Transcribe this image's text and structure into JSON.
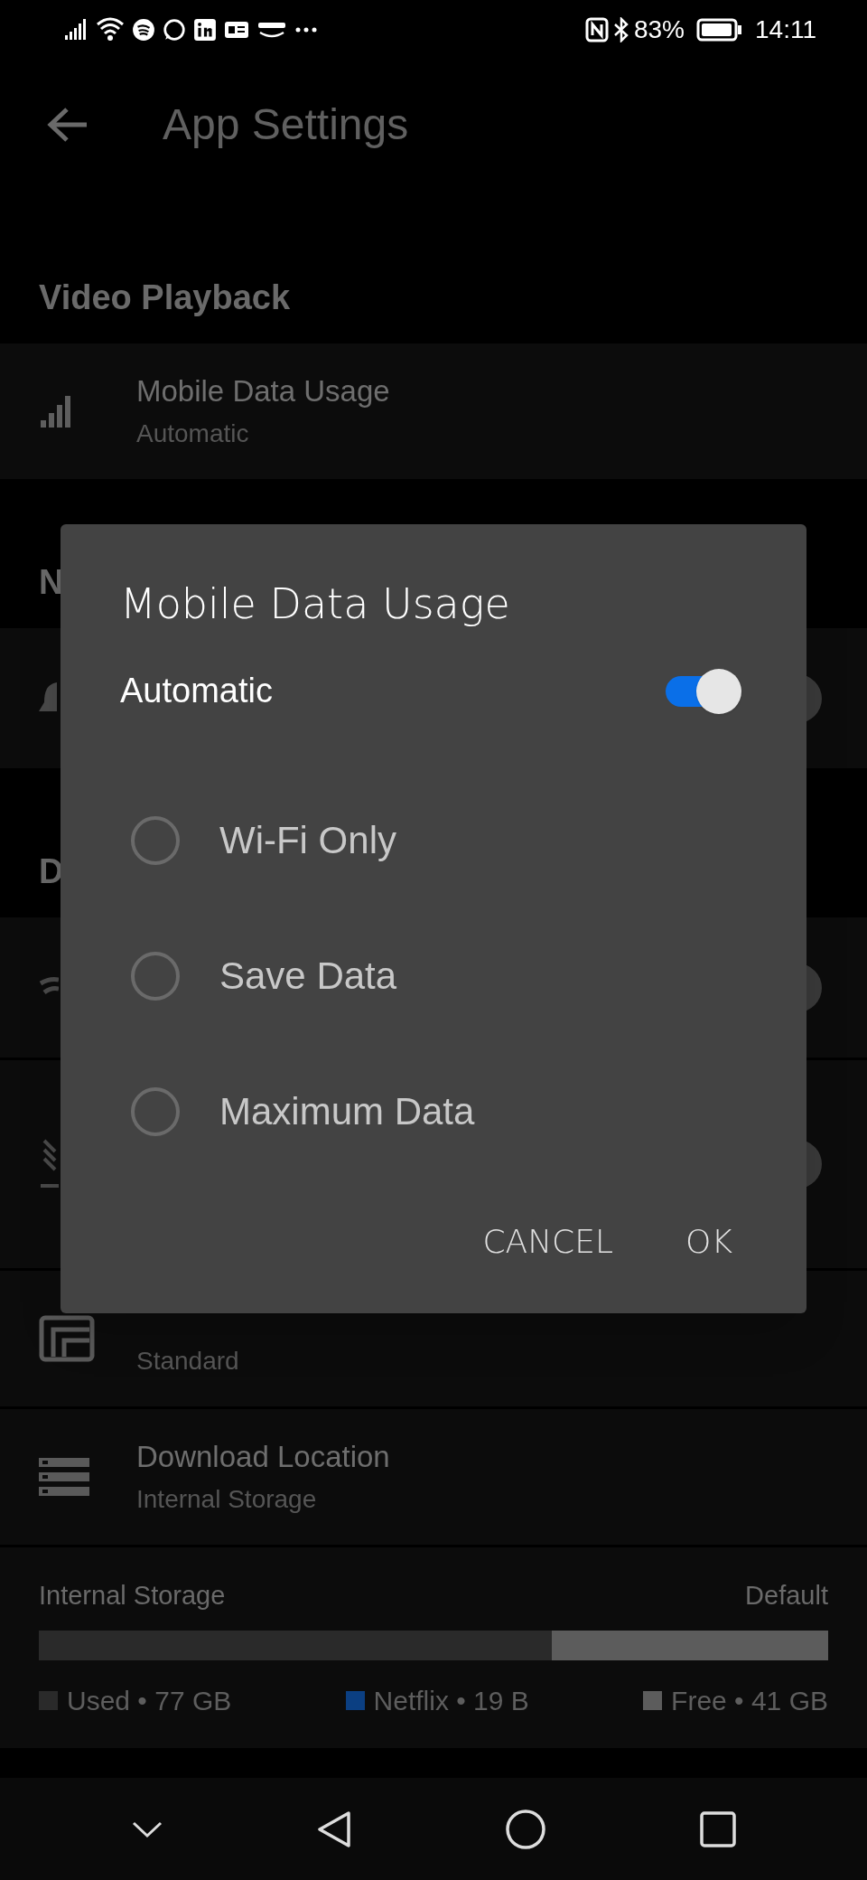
{
  "status_bar": {
    "battery": "83%",
    "time": "14:11"
  },
  "app_bar": {
    "title": "App Settings"
  },
  "sections": [
    {
      "header": "Video Playback",
      "rows": [
        {
          "kind": "value",
          "title": "Mobile Data Usage",
          "subtitle": "Automatic"
        }
      ]
    },
    {
      "header": "N",
      "rows": [
        {
          "kind": "toggle"
        }
      ]
    },
    {
      "header": "D",
      "rows": [
        {
          "kind": "toggle"
        },
        {
          "kind": "tall-toggle"
        },
        {
          "kind": "value",
          "subtitle": "Standard"
        },
        {
          "kind": "value",
          "title": "Download Location",
          "subtitle": "Internal Storage"
        }
      ]
    }
  ],
  "storage": {
    "label": "Internal Storage",
    "default": "Default",
    "level": 0.65,
    "legend": [
      {
        "label": "Used • 77 GB",
        "color": "#2a2a2a"
      },
      {
        "label": "Netflix • 19 B",
        "color": "#0b3f82"
      },
      {
        "label": "Free • 41 GB",
        "color": "#5c5c5c"
      }
    ]
  },
  "dialog": {
    "title": "Mobile Data Usage",
    "automatic": {
      "label": "Automatic",
      "on": true
    },
    "options": [
      {
        "label": "Wi-Fi Only",
        "selected": false
      },
      {
        "label": "Save Data",
        "selected": false
      },
      {
        "label": "Maximum Data",
        "selected": false
      }
    ],
    "buttons": [
      "CANCEL",
      "OK"
    ]
  }
}
